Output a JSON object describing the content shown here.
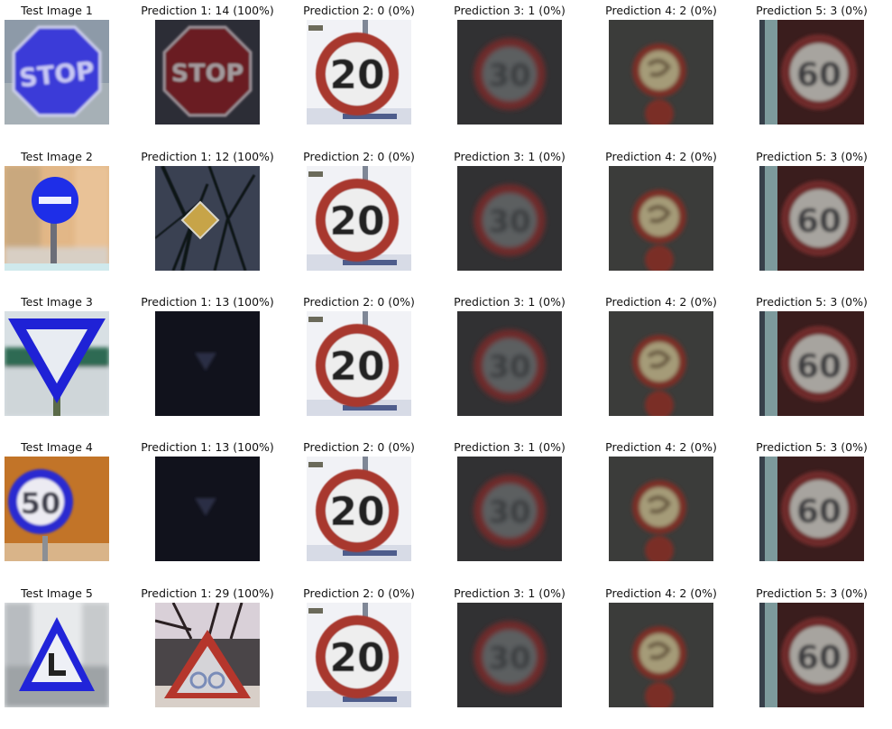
{
  "rows": [
    {
      "test_title": "Test Image 1",
      "test_icon": "stop-sign-blue-icon",
      "predictions": [
        {
          "title": "Prediction 1: 14 (100%)",
          "icon": "stop-sign-icon"
        },
        {
          "title": "Prediction 2: 0 (0%)",
          "icon": "speed-limit-20-icon"
        },
        {
          "title": "Prediction 3: 1 (0%)",
          "icon": "speed-limit-30-dark-icon"
        },
        {
          "title": "Prediction 4: 2 (0%)",
          "icon": "speed-limit-50-dark-icon"
        },
        {
          "title": "Prediction 5: 3 (0%)",
          "icon": "speed-limit-60-icon"
        }
      ]
    },
    {
      "test_title": "Test Image 2",
      "test_icon": "no-entry-sign-icon",
      "predictions": [
        {
          "title": "Prediction 1: 12 (100%)",
          "icon": "priority-road-sign-icon"
        },
        {
          "title": "Prediction 2: 0 (0%)",
          "icon": "speed-limit-20-icon"
        },
        {
          "title": "Prediction 3: 1 (0%)",
          "icon": "speed-limit-30-dark-icon"
        },
        {
          "title": "Prediction 4: 2 (0%)",
          "icon": "speed-limit-50-dark-icon"
        },
        {
          "title": "Prediction 5: 3 (0%)",
          "icon": "speed-limit-60-icon"
        }
      ]
    },
    {
      "test_title": "Test Image 3",
      "test_icon": "yield-sign-blue-icon",
      "predictions": [
        {
          "title": "Prediction 1: 13 (100%)",
          "icon": "yield-sign-dark-icon"
        },
        {
          "title": "Prediction 2: 0 (0%)",
          "icon": "speed-limit-20-icon"
        },
        {
          "title": "Prediction 3: 1 (0%)",
          "icon": "speed-limit-30-dark-icon"
        },
        {
          "title": "Prediction 4: 2 (0%)",
          "icon": "speed-limit-50-dark-icon"
        },
        {
          "title": "Prediction 5: 3 (0%)",
          "icon": "speed-limit-60-icon"
        }
      ]
    },
    {
      "test_title": "Test Image 4",
      "test_icon": "speed-limit-50-blue-icon",
      "predictions": [
        {
          "title": "Prediction 1: 13 (100%)",
          "icon": "yield-sign-dark-icon"
        },
        {
          "title": "Prediction 2: 0 (0%)",
          "icon": "speed-limit-20-icon"
        },
        {
          "title": "Prediction 3: 1 (0%)",
          "icon": "speed-limit-30-dark-icon"
        },
        {
          "title": "Prediction 4: 2 (0%)",
          "icon": "speed-limit-50-dark-icon"
        },
        {
          "title": "Prediction 5: 3 (0%)",
          "icon": "speed-limit-60-icon"
        }
      ]
    },
    {
      "test_title": "Test Image 5",
      "test_icon": "warning-triangle-blue-icon",
      "predictions": [
        {
          "title": "Prediction 1: 29 (100%)",
          "icon": "bicycle-crossing-sign-icon"
        },
        {
          "title": "Prediction 2: 0 (0%)",
          "icon": "speed-limit-20-icon"
        },
        {
          "title": "Prediction 3: 1 (0%)",
          "icon": "speed-limit-30-dark-icon"
        },
        {
          "title": "Prediction 4: 2 (0%)",
          "icon": "speed-limit-50-dark-icon"
        },
        {
          "title": "Prediction 5: 3 (0%)",
          "icon": "speed-limit-60-icon"
        }
      ]
    }
  ],
  "sign_texts": {
    "stop": "STOP",
    "speed_20": "20",
    "speed_30": "30",
    "speed_50": "50",
    "speed_60": "60"
  }
}
